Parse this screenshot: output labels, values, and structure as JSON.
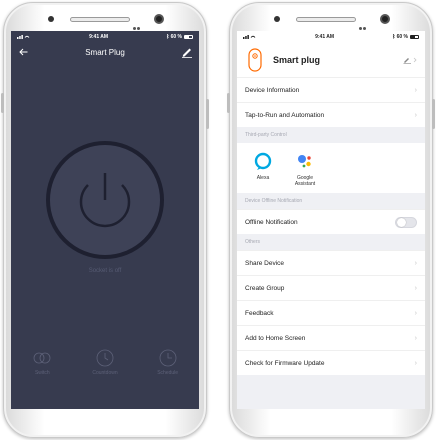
{
  "status_bar": {
    "time": "9:41 AM",
    "battery": "60 %"
  },
  "plug_screen": {
    "title": "Smart Plug",
    "status_text": "Socket is off",
    "bottom_items": [
      {
        "label": "Switch",
        "icon": "toggle-icon"
      },
      {
        "label": "Countdown",
        "icon": "timer-icon"
      },
      {
        "label": "Schedule",
        "icon": "clock-icon"
      }
    ],
    "colors": {
      "background": "#373b4f",
      "ring": "#1e2030",
      "muted": "#565b73"
    }
  },
  "settings_screen": {
    "device_name": "Smart plug",
    "rows_top": [
      {
        "label": "Device Information"
      },
      {
        "label": "Tap-to-Run and Automation"
      }
    ],
    "section_third_party": "Third-party Control",
    "third_party": [
      {
        "label": "Alexa",
        "icon": "alexa-icon"
      },
      {
        "label": "Google Assistant",
        "icon": "google-assistant-icon"
      }
    ],
    "section_offline": "Device Offline Notification",
    "offline_notification": {
      "label": "Offline Notification",
      "enabled": false
    },
    "section_others": "Others",
    "rows_others": [
      {
        "label": "Share Device"
      },
      {
        "label": "Create Group"
      },
      {
        "label": "Feedback"
      },
      {
        "label": "Add to Home Screen"
      },
      {
        "label": "Check for Firmware Update"
      }
    ],
    "colors": {
      "accent": "#ff6a00",
      "alexa": "#00a8e1",
      "background": "#eff0f4"
    }
  }
}
